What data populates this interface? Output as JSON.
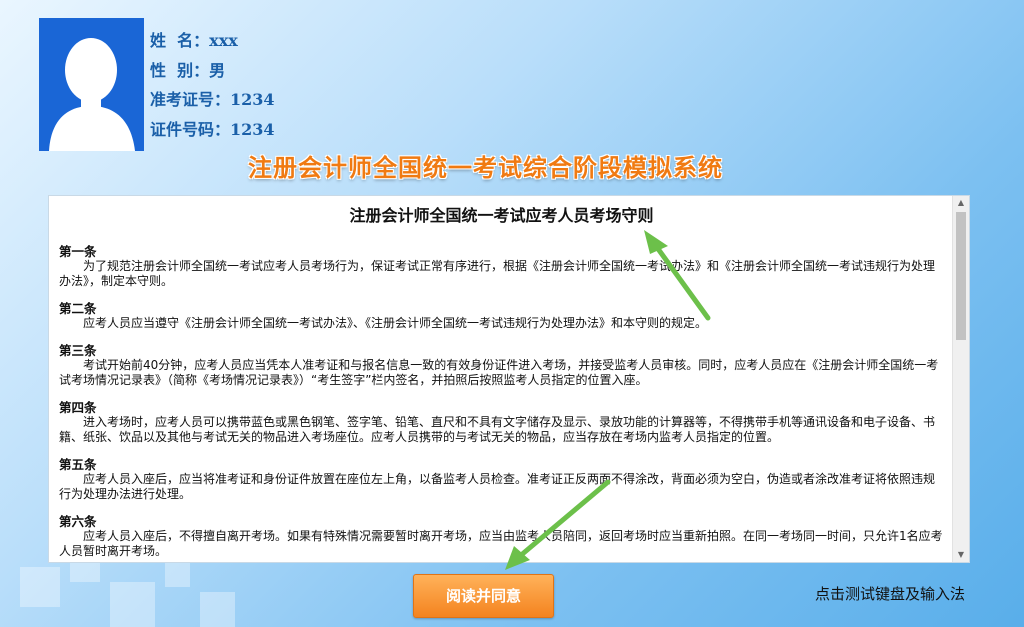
{
  "header": {
    "name_label": "姓  名：",
    "name_value": "xxx",
    "gender_label": "性  别：",
    "gender_value": "男",
    "admission_label": "准考证号：",
    "admission_value": "1234",
    "id_label": "证件号码：",
    "id_value": "1234"
  },
  "system_title": "注册会计师全国统一考试综合阶段模拟系统",
  "rules": {
    "title": "注册会计师全国统一考试应考人员考场守则",
    "articles": [
      {
        "head": "第一条",
        "body": "为了规范注册会计师全国统一考试应考人员考场行为，保证考试正常有序进行，根据《注册会计师全国统一考试办法》和《注册会计师全国统一考试违规行为处理办法》，制定本守则。"
      },
      {
        "head": "第二条",
        "body": "应考人员应当遵守《注册会计师全国统一考试办法》、《注册会计师全国统一考试违规行为处理办法》和本守则的规定。"
      },
      {
        "head": "第三条",
        "body": "考试开始前40分钟，应考人员应当凭本人准考证和与报名信息一致的有效身份证件进入考场，并接受监考人员审核。同时，应考人员应在《注册会计师全国统一考试考场情况记录表》（简称《考场情况记录表》）“考生签字”栏内签名，并拍照后按照监考人员指定的位置入座。"
      },
      {
        "head": "第四条",
        "body": "进入考场时，应考人员可以携带蓝色或黑色钢笔、签字笔、铅笔、直尺和不具有文字储存及显示、录放功能的计算器等，不得携带手机等通讯设备和电子设备、书籍、纸张、饮品以及其他与考试无关的物品进入考场座位。应考人员携带的与考试无关的物品，应当存放在考场内监考人员指定的位置。"
      },
      {
        "head": "第五条",
        "body": "应考人员入座后，应当将准考证和身份证件放置在座位左上角，以备监考人员检查。准考证正反两面不得涂改，背面必须为空白，伪造或者涂改准考证将依照违规行为处理办法进行处理。"
      },
      {
        "head": "第六条",
        "body": "应考人员入座后，不得擅自离开考场。如果有特殊情况需要暂时离开考场，应当由监考人员陪同，返回考场时应当重新拍照。在同一考场同一时间，只允许1名应考人员暂时离开考场。"
      }
    ]
  },
  "buttons": {
    "agree": "阅读并同意",
    "test_keyboard": "点击测试键盘及输入法"
  },
  "icons": {
    "scroll_up": "▲",
    "scroll_down": "▼"
  },
  "colors": {
    "accent": "#f07a12",
    "label": "#1a5fa8",
    "arrow": "#6cc04a"
  }
}
